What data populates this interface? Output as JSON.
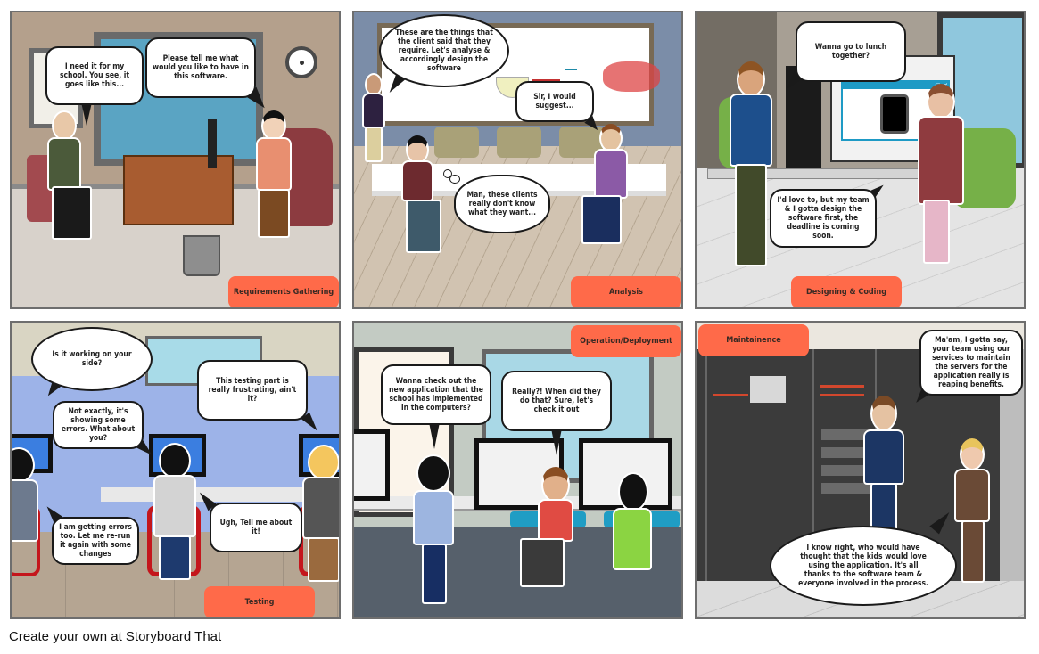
{
  "storyboard": {
    "footer_text": "Create your own at Storyboard That",
    "label_color": "#ff6a49",
    "panels": [
      {
        "label": "Requirements Gathering",
        "bubbles": [
          "I need it for my school. You see, it goes like this...",
          "Please tell me what would you like to have in this software."
        ]
      },
      {
        "label": "Analysis",
        "bubbles": [
          "These are the things that the client said that they require. Let's analyse & accordingly design the software",
          "Sir, I would suggest...",
          "Man, these clients really don't know what they want..."
        ]
      },
      {
        "label": "Designing & Coding",
        "bubbles": [
          "Wanna go to lunch together?",
          "I'd love to, but my team & I gotta design the software first, the deadline is coming soon."
        ]
      },
      {
        "label": "Testing",
        "bubbles": [
          "Is it working on your side?",
          "This testing part is really frustrating, ain't it?",
          "Not exactly, it's showing some errors. What about you?",
          "I am getting errors too. Let me re-run it again with some changes",
          "Ugh, Tell me about it!"
        ]
      },
      {
        "label": "Operation/Deployment",
        "bubbles": [
          "Wanna check out the new application that the school has implemented in the computers?",
          "Really?! When did they do that? Sure, let's check it out"
        ]
      },
      {
        "label": "Maintainence",
        "bubbles": [
          "Ma'am, I gotta say, your team using our services to maintain the servers for the application really is reaping benefits.",
          "I know right, who would have thought that the kids would love using the application. It's all thanks to the software team & everyone involved in the process."
        ]
      }
    ]
  }
}
